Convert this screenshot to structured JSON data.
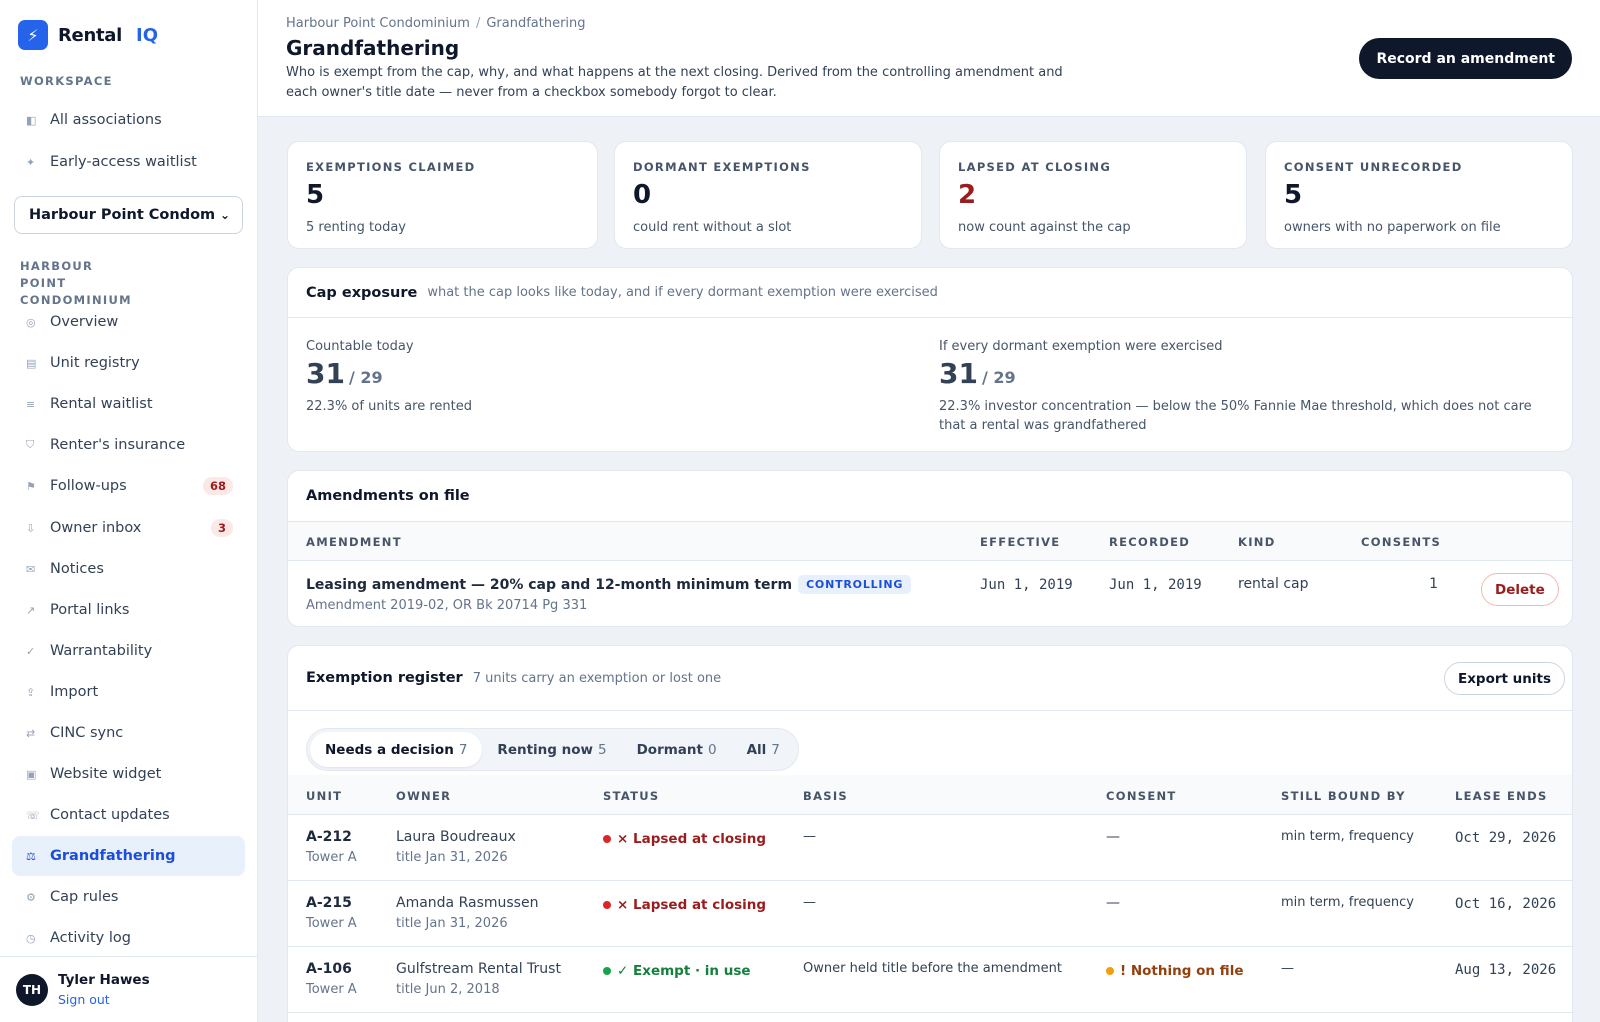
{
  "brand": {
    "name": "Rental",
    "suffix": "IQ"
  },
  "sidebar": {
    "workspace_label": "WORKSPACE",
    "workspace_items": [
      {
        "label": "All associations",
        "icon": "sidebar-panel-icon"
      },
      {
        "label": "Early-access waitlist",
        "icon": "sparkle-icon"
      }
    ],
    "association_select": "Harbour Point Condominium",
    "assoc_label": "HARBOUR POINT CONDOMINIUM",
    "items": [
      {
        "label": "Overview",
        "icon": "target-icon",
        "glyph": "◎"
      },
      {
        "label": "Unit registry",
        "icon": "registry-icon",
        "glyph": "▤"
      },
      {
        "label": "Rental waitlist",
        "icon": "list-icon",
        "glyph": "≡"
      },
      {
        "label": "Renter's insurance",
        "icon": "shield-icon",
        "glyph": "⛉"
      },
      {
        "label": "Follow-ups",
        "icon": "flag-icon",
        "glyph": "⚑",
        "badge": "68"
      },
      {
        "label": "Owner inbox",
        "icon": "download-icon",
        "glyph": "⇩",
        "badge": "3"
      },
      {
        "label": "Notices",
        "icon": "mail-icon",
        "glyph": "✉"
      },
      {
        "label": "Portal links",
        "icon": "external-link-icon",
        "glyph": "↗"
      },
      {
        "label": "Warrantability",
        "icon": "check-icon",
        "glyph": "✓"
      },
      {
        "label": "Import",
        "icon": "upload-icon",
        "glyph": "⇪"
      },
      {
        "label": "CINC sync",
        "icon": "sync-icon",
        "glyph": "⇄"
      },
      {
        "label": "Website widget",
        "icon": "widget-icon",
        "glyph": "▣"
      },
      {
        "label": "Contact updates",
        "icon": "phone-icon",
        "glyph": "☏"
      },
      {
        "label": "Grandfathering",
        "icon": "scale-icon",
        "glyph": "⚖",
        "active": true
      },
      {
        "label": "Cap rules",
        "icon": "gear-icon",
        "glyph": "⚙"
      },
      {
        "label": "Activity log",
        "icon": "clock-icon",
        "glyph": "◷"
      }
    ],
    "user": {
      "initials": "TH",
      "name": "Tyler Hawes",
      "signout": "Sign out"
    }
  },
  "header": {
    "breadcrumb": [
      "Harbour Point Condominium",
      "Grandfathering"
    ],
    "title": "Grandfathering",
    "description": "Who is exempt from the cap, why, and what happens at the next closing. Derived from the controlling amendment and each owner's title date — never from a checkbox somebody forgot to clear.",
    "primary_button": "Record an amendment"
  },
  "stats": [
    {
      "label": "EXEMPTIONS CLAIMED",
      "value": "5",
      "sub": "5 renting today"
    },
    {
      "label": "DORMANT EXEMPTIONS",
      "value": "0",
      "sub": "could rent without a slot"
    },
    {
      "label": "LAPSED AT CLOSING",
      "value": "2",
      "sub": "now count against the cap",
      "color": "#9b1c1c"
    },
    {
      "label": "CONSENT UNRECORDED",
      "value": "5",
      "sub": "owners with no paperwork on file"
    }
  ],
  "cap_exposure": {
    "title": "Cap exposure",
    "hint": "what the cap looks like today, and if every dormant exemption were exercised",
    "today": {
      "label": "Countable today",
      "value": "31",
      "of": "/ 29",
      "note": "22.3% of units are rented"
    },
    "dormant": {
      "label": "If every dormant exemption were exercised",
      "value": "31",
      "of": "/ 29",
      "note": "22.3% investor concentration — below the 50% Fannie Mae threshold, which does not care that a rental was grandfathered"
    }
  },
  "amendments": {
    "title": "Amendments on file",
    "columns": [
      "AMENDMENT",
      "EFFECTIVE",
      "RECORDED",
      "KIND",
      "CONSENTS"
    ],
    "rows": [
      {
        "name": "Leasing amendment — 20% cap and 12-month minimum term",
        "tag": "CONTROLLING",
        "ref": "Amendment 2019-02, OR Bk 20714 Pg 331",
        "effective": "Jun 1, 2019",
        "recorded": "Jun 1, 2019",
        "kind": "rental cap",
        "consents": "1",
        "action": "Delete"
      }
    ]
  },
  "register": {
    "title": "Exemption register",
    "hint": "7 units carry an exemption or lost one",
    "export_button": "Export units",
    "tabs": [
      {
        "label": "Needs a decision",
        "count": "7",
        "active": true
      },
      {
        "label": "Renting now",
        "count": "5"
      },
      {
        "label": "Dormant",
        "count": "0"
      },
      {
        "label": "All",
        "count": "7"
      }
    ],
    "columns": [
      "UNIT",
      "OWNER",
      "STATUS",
      "BASIS",
      "CONSENT",
      "STILL BOUND BY",
      "LEASE ENDS"
    ],
    "rows": [
      {
        "unit": "A-212",
        "building": "Tower A",
        "owner": "Laura Boudreaux",
        "title": "title Jan 31, 2026",
        "status": "× Lapsed at closing",
        "status_kind": "lapsed",
        "basis": "—",
        "consent": "—",
        "consent_kind": "plain",
        "bound": "min term, frequency",
        "lease_ends": "Oct 29, 2026"
      },
      {
        "unit": "A-215",
        "building": "Tower A",
        "owner": "Amanda Rasmussen",
        "title": "title Jan 31, 2026",
        "status": "× Lapsed at closing",
        "status_kind": "lapsed",
        "basis": "—",
        "consent": "—",
        "consent_kind": "plain",
        "bound": "min term, frequency",
        "lease_ends": "Oct 16, 2026"
      },
      {
        "unit": "A-106",
        "building": "Tower A",
        "owner": "Gulfstream Rental Trust",
        "title": "title Jun 2, 2018",
        "status": "✓ Exempt · in use",
        "status_kind": "exempt",
        "basis": "Owner held title before the amendment",
        "consent": "! Nothing on file",
        "consent_kind": "warn",
        "bound": "—",
        "lease_ends": "Aug 13, 2026"
      }
    ]
  },
  "colors": {
    "accent": "#2563eb",
    "navy": "#0f172a",
    "danger": "#9b1c1c",
    "success": "#15803d",
    "warning": "#92400e"
  }
}
